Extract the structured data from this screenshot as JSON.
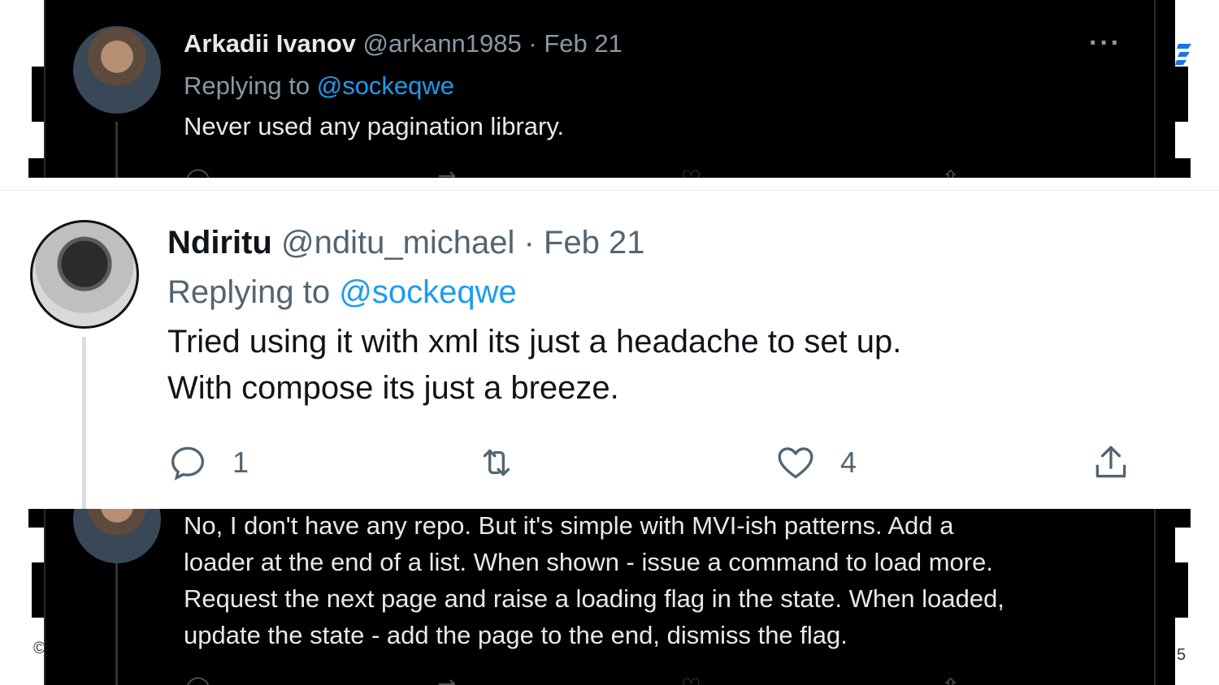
{
  "top_tweet": {
    "author_name": "Arkadii Ivanov",
    "handle": "@arkann1985",
    "date": "· Feb 21",
    "replying_label": "Replying to",
    "replying_handle": "@sockeqwe",
    "text": "Never used any pagination library.",
    "more": "···"
  },
  "main_tweet": {
    "author_name": "Ndiritu",
    "handle": "@nditu_michael",
    "date": "· Feb 21",
    "replying_label": "Replying to",
    "replying_handle": "@sockeqwe",
    "text_line1": "Tried using it with xml its just a headache to set up.",
    "text_line2": "With compose its just a breeze.",
    "reply_count": "1",
    "like_count": "4"
  },
  "bottom_tweet": {
    "line1": "No, I don't have any repo. But it's simple with MVI-ish patterns. Add a",
    "line2": "loader at the end of a list. When shown - issue a command to load more.",
    "line3": "Request the next page and raise a loading flag in the state. When loaded,",
    "line4": "update the state - add the page to the end, dismiss the flag."
  },
  "slide": {
    "copyright_glyph": "©",
    "page_number_fragment": "5"
  },
  "colors": {
    "link": "#1d9bf0",
    "dark_bg": "#000000",
    "light_muted": "#536471"
  }
}
